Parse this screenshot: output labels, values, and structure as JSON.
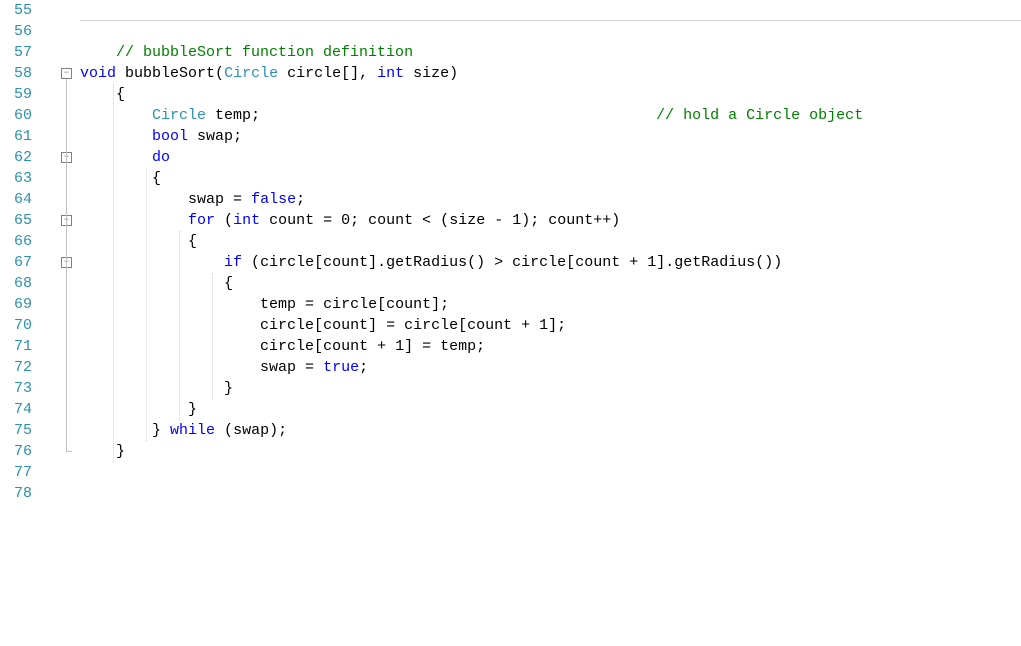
{
  "startLine": 55,
  "endLine": 78,
  "lines": {
    "55": {
      "tokens": []
    },
    "56": {
      "tokens": []
    },
    "57": {
      "indent": "    ",
      "tokens": [
        {
          "cls": "c",
          "t": "// bubbleSort function definition"
        }
      ]
    },
    "58": {
      "fold": "minus",
      "tokens": [
        {
          "cls": "k",
          "t": "void"
        },
        {
          "cls": "",
          "t": " "
        },
        {
          "cls": "fn",
          "t": "bubbleSort"
        },
        {
          "cls": "op",
          "t": "("
        },
        {
          "cls": "t",
          "t": "Circle"
        },
        {
          "cls": "",
          "t": " "
        },
        {
          "cls": "id",
          "t": "circle"
        },
        {
          "cls": "op",
          "t": "[], "
        },
        {
          "cls": "k",
          "t": "int"
        },
        {
          "cls": "",
          "t": " "
        },
        {
          "cls": "id",
          "t": "size"
        },
        {
          "cls": "op",
          "t": ")"
        }
      ]
    },
    "59": {
      "indent": "    ",
      "tokens": [
        {
          "cls": "op",
          "t": "{"
        }
      ]
    },
    "60": {
      "indent": "        ",
      "tokens": [
        {
          "cls": "t",
          "t": "Circle"
        },
        {
          "cls": "",
          "t": " "
        },
        {
          "cls": "id",
          "t": "temp"
        },
        {
          "cls": "op",
          "t": ";"
        },
        {
          "cls": "",
          "t": "                                            "
        },
        {
          "cls": "c",
          "t": "// hold a Circle object"
        }
      ]
    },
    "61": {
      "indent": "        ",
      "tokens": [
        {
          "cls": "k",
          "t": "bool"
        },
        {
          "cls": "",
          "t": " "
        },
        {
          "cls": "id",
          "t": "swap"
        },
        {
          "cls": "op",
          "t": ";"
        }
      ]
    },
    "62": {
      "fold": "minus",
      "indent": "        ",
      "tokens": [
        {
          "cls": "k",
          "t": "do"
        }
      ]
    },
    "63": {
      "indent": "        ",
      "tokens": [
        {
          "cls": "op",
          "t": "{"
        }
      ]
    },
    "64": {
      "indent": "            ",
      "tokens": [
        {
          "cls": "id",
          "t": "swap"
        },
        {
          "cls": "op",
          "t": " = "
        },
        {
          "cls": "k",
          "t": "false"
        },
        {
          "cls": "op",
          "t": ";"
        }
      ]
    },
    "65": {
      "fold": "minus",
      "indent": "            ",
      "tokens": [
        {
          "cls": "k",
          "t": "for"
        },
        {
          "cls": "op",
          "t": " ("
        },
        {
          "cls": "k",
          "t": "int"
        },
        {
          "cls": "",
          "t": " "
        },
        {
          "cls": "id",
          "t": "count"
        },
        {
          "cls": "op",
          "t": " = "
        },
        {
          "cls": "num",
          "t": "0"
        },
        {
          "cls": "op",
          "t": "; "
        },
        {
          "cls": "id",
          "t": "count"
        },
        {
          "cls": "op",
          "t": " < ("
        },
        {
          "cls": "id",
          "t": "size"
        },
        {
          "cls": "op",
          "t": " - "
        },
        {
          "cls": "num",
          "t": "1"
        },
        {
          "cls": "op",
          "t": "); "
        },
        {
          "cls": "id",
          "t": "count"
        },
        {
          "cls": "op",
          "t": "++)"
        }
      ]
    },
    "66": {
      "indent": "            ",
      "tokens": [
        {
          "cls": "op",
          "t": "{"
        }
      ]
    },
    "67": {
      "fold": "minus",
      "indent": "                ",
      "tokens": [
        {
          "cls": "k",
          "t": "if"
        },
        {
          "cls": "op",
          "t": " ("
        },
        {
          "cls": "id",
          "t": "circle"
        },
        {
          "cls": "op",
          "t": "["
        },
        {
          "cls": "id",
          "t": "count"
        },
        {
          "cls": "op",
          "t": "]."
        },
        {
          "cls": "fn",
          "t": "getRadius"
        },
        {
          "cls": "op",
          "t": "() > "
        },
        {
          "cls": "id",
          "t": "circle"
        },
        {
          "cls": "op",
          "t": "["
        },
        {
          "cls": "id",
          "t": "count"
        },
        {
          "cls": "op",
          "t": " + "
        },
        {
          "cls": "num",
          "t": "1"
        },
        {
          "cls": "op",
          "t": "]."
        },
        {
          "cls": "fn",
          "t": "getRadius"
        },
        {
          "cls": "op",
          "t": "())"
        }
      ]
    },
    "68": {
      "indent": "                ",
      "tokens": [
        {
          "cls": "op",
          "t": "{"
        }
      ]
    },
    "69": {
      "indent": "                    ",
      "tokens": [
        {
          "cls": "id",
          "t": "temp"
        },
        {
          "cls": "op",
          "t": " = "
        },
        {
          "cls": "id",
          "t": "circle"
        },
        {
          "cls": "op",
          "t": "["
        },
        {
          "cls": "id",
          "t": "count"
        },
        {
          "cls": "op",
          "t": "];"
        }
      ]
    },
    "70": {
      "indent": "                    ",
      "tokens": [
        {
          "cls": "id",
          "t": "circle"
        },
        {
          "cls": "op",
          "t": "["
        },
        {
          "cls": "id",
          "t": "count"
        },
        {
          "cls": "op",
          "t": "] = "
        },
        {
          "cls": "id",
          "t": "circle"
        },
        {
          "cls": "op",
          "t": "["
        },
        {
          "cls": "id",
          "t": "count"
        },
        {
          "cls": "op",
          "t": " + "
        },
        {
          "cls": "num",
          "t": "1"
        },
        {
          "cls": "op",
          "t": "];"
        }
      ]
    },
    "71": {
      "indent": "                    ",
      "tokens": [
        {
          "cls": "id",
          "t": "circle"
        },
        {
          "cls": "op",
          "t": "["
        },
        {
          "cls": "id",
          "t": "count"
        },
        {
          "cls": "op",
          "t": " + "
        },
        {
          "cls": "num",
          "t": "1"
        },
        {
          "cls": "op",
          "t": "] = "
        },
        {
          "cls": "id",
          "t": "temp"
        },
        {
          "cls": "op",
          "t": ";"
        }
      ]
    },
    "72": {
      "indent": "                    ",
      "tokens": [
        {
          "cls": "id",
          "t": "swap"
        },
        {
          "cls": "op",
          "t": " = "
        },
        {
          "cls": "k",
          "t": "true"
        },
        {
          "cls": "op",
          "t": ";"
        }
      ]
    },
    "73": {
      "indent": "                ",
      "tokens": [
        {
          "cls": "op",
          "t": "}"
        }
      ]
    },
    "74": {
      "indent": "            ",
      "tokens": [
        {
          "cls": "op",
          "t": "}"
        }
      ]
    },
    "75": {
      "indent": "        ",
      "tokens": [
        {
          "cls": "op",
          "t": "} "
        },
        {
          "cls": "k",
          "t": "while"
        },
        {
          "cls": "op",
          "t": " ("
        },
        {
          "cls": "id",
          "t": "swap"
        },
        {
          "cls": "op",
          "t": ");"
        }
      ]
    },
    "76": {
      "foldEnd": true,
      "indent": "    ",
      "tokens": [
        {
          "cls": "op",
          "t": "}"
        }
      ]
    },
    "77": {
      "tokens": []
    },
    "78": {
      "tokens": []
    }
  },
  "indentGuides": [
    {
      "col": 0,
      "from": 59,
      "to": 76
    },
    {
      "col": 1,
      "from": 63,
      "to": 75
    },
    {
      "col": 2,
      "from": 66,
      "to": 74
    },
    {
      "col": 3,
      "from": 68,
      "to": 73
    }
  ]
}
